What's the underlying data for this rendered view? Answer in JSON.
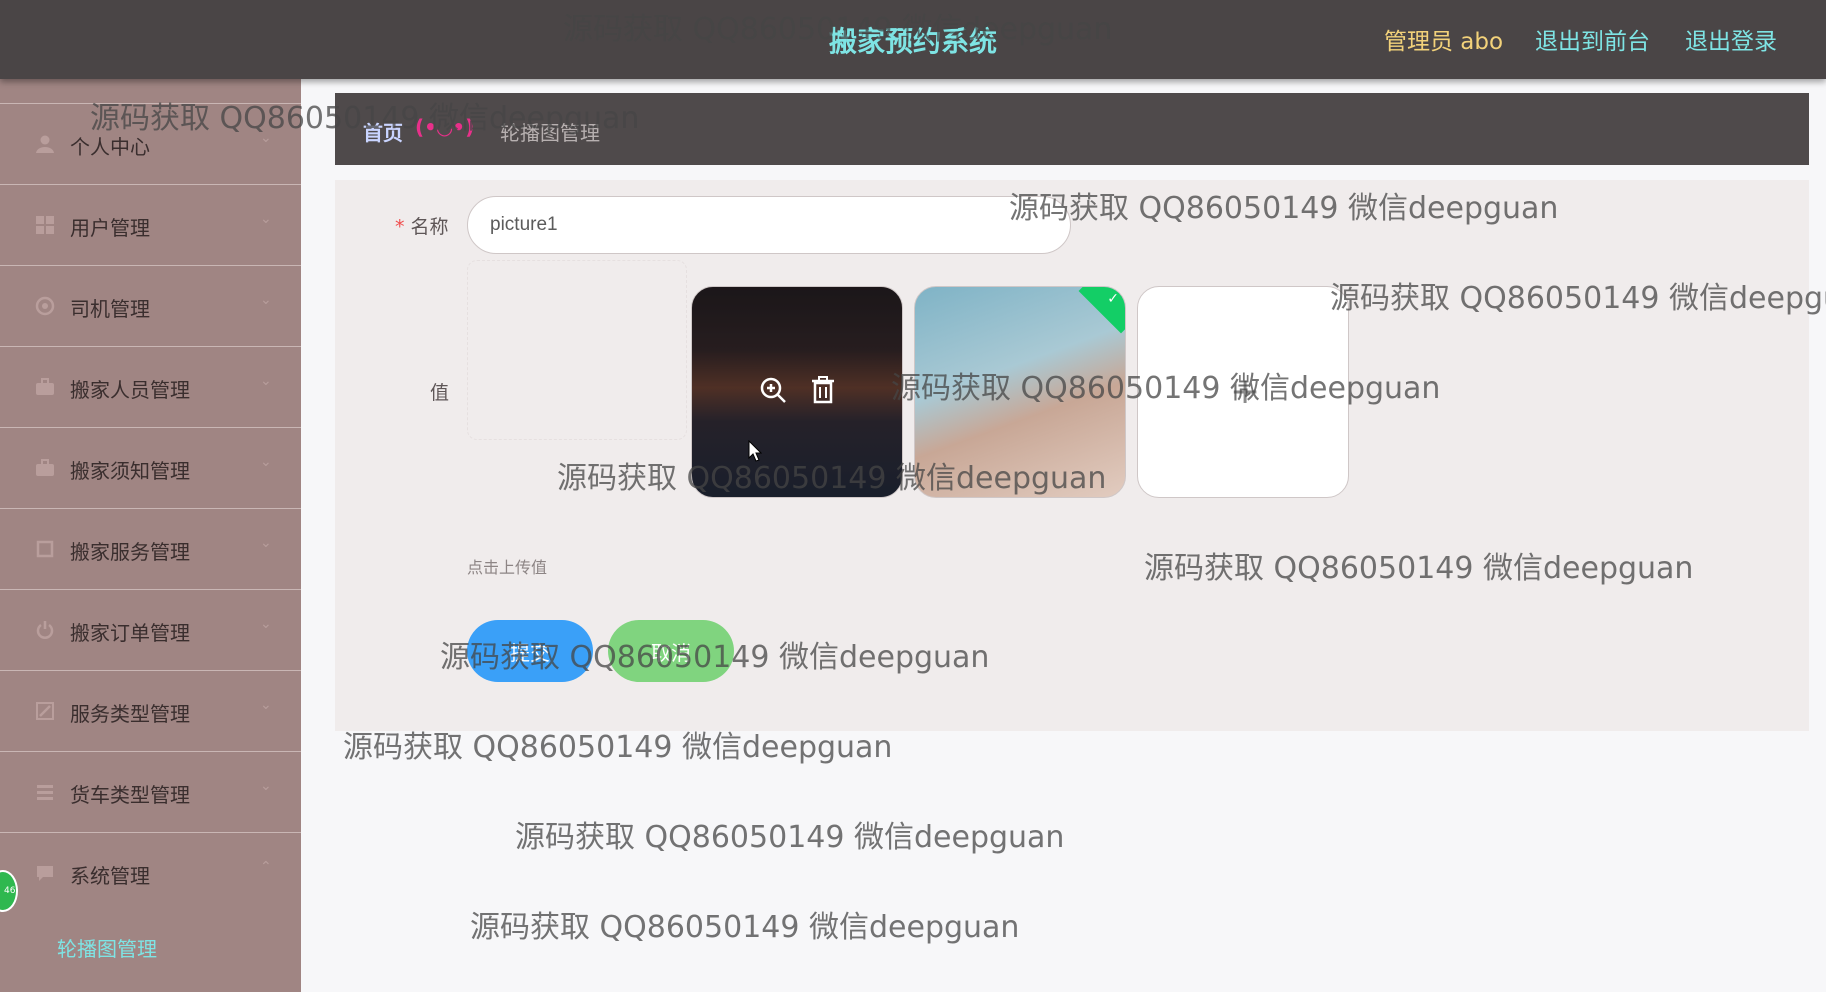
{
  "header": {
    "title": "搬家预约系统",
    "admin": "管理员 abo",
    "to_front": "退出到前台",
    "logout": "退出登录"
  },
  "sidebar": {
    "items": [
      {
        "label": "个人中心",
        "icon": "user-icon"
      },
      {
        "label": "用户管理",
        "icon": "grid-icon"
      },
      {
        "label": "司机管理",
        "icon": "circle-icon"
      },
      {
        "label": "搬家人员管理",
        "icon": "briefcase-icon"
      },
      {
        "label": "搬家须知管理",
        "icon": "briefcase-icon"
      },
      {
        "label": "搬家服务管理",
        "icon": "square-icon"
      },
      {
        "label": "搬家订单管理",
        "icon": "power-icon"
      },
      {
        "label": "服务类型管理",
        "icon": "edit-icon"
      },
      {
        "label": "货车类型管理",
        "icon": "list-icon"
      },
      {
        "label": "系统管理",
        "icon": "chat-icon"
      }
    ],
    "submenu_label": "轮播图管理",
    "badge": "46"
  },
  "breadcrumb": {
    "home": "首页",
    "face": "(•◡•)",
    "current": "轮播图管理"
  },
  "form": {
    "name_label": "名称",
    "name_value": "picture1",
    "value_label": "值",
    "hint": "点击上传值",
    "submit_label": "提交",
    "cancel_label": "取消",
    "upload_plus": "+"
  },
  "watermark": "源码获取 QQ86050149 微信deepguan",
  "colors": {
    "header_bg": "#4a4546",
    "sidebar_bg": "#a08583",
    "accent_cyan": "#7ee4e4",
    "admin_gold": "#f3d27a",
    "submit_blue": "#3aa0f8",
    "cancel_green": "#80d47f"
  }
}
